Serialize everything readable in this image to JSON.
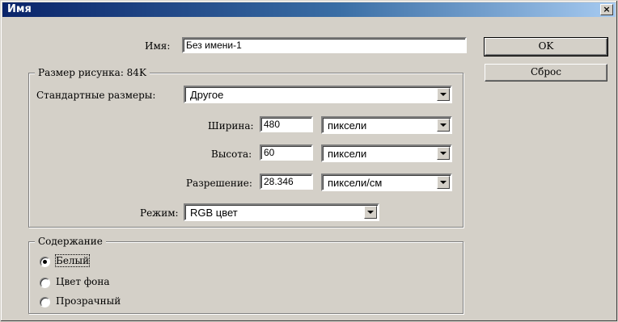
{
  "window": {
    "title": "Имя",
    "close_label": "×"
  },
  "name": {
    "label": "Имя:",
    "value": "Без имени-1"
  },
  "image_size": {
    "group_title": "Размер рисунка: 84K",
    "preset_label": "Стандартные размеры:",
    "preset_value": "Другое",
    "width_label": "Ширина:",
    "width_value": "480",
    "width_unit": "пиксели",
    "height_label": "Высота:",
    "height_value": "60",
    "height_unit": "пиксели",
    "resolution_label": "Разрешение:",
    "resolution_value": "28.346",
    "resolution_unit": "пиксели/см",
    "mode_label": "Режим:",
    "mode_value": "RGB цвет"
  },
  "contents": {
    "group_title": "Содержание",
    "options": [
      {
        "label": "Белый",
        "checked": true
      },
      {
        "label": "Цвет фона",
        "checked": false
      },
      {
        "label": "Прозрачный",
        "checked": false
      }
    ]
  },
  "buttons": {
    "ok": "OK",
    "reset": "Сброс"
  }
}
